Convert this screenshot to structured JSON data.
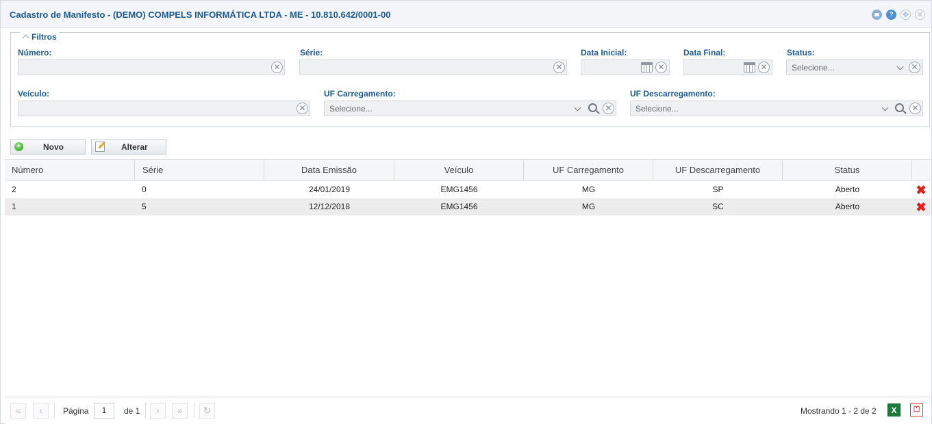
{
  "window": {
    "title": "Cadastro de Manifesto - (DEMO) COMPELS INFORMÁTICA LTDA - ME - 10.810.642/0001-00",
    "icons": [
      "minimize-icon",
      "help-icon",
      "move-icon",
      "close-icon"
    ]
  },
  "filters": {
    "legend": "Filtros",
    "numero": {
      "label": "Número:",
      "value": ""
    },
    "serie": {
      "label": "Série:",
      "value": ""
    },
    "data_inicial": {
      "label": "Data Inicial:",
      "value": ""
    },
    "data_final": {
      "label": "Data Final:",
      "value": ""
    },
    "status": {
      "label": "Status:",
      "placeholder": "Selecione..."
    },
    "veiculo": {
      "label": "Veículo:",
      "value": ""
    },
    "uf_carregamento": {
      "label": "UF Carregamento:",
      "placeholder": "Selecione..."
    },
    "uf_descarregamento": {
      "label": "UF Descarregamento:",
      "placeholder": "Selecione..."
    }
  },
  "toolbar": {
    "novo": "Novo",
    "alterar": "Alterar"
  },
  "table": {
    "headers": [
      "Número",
      "Série",
      "Data Emissão",
      "Veículo",
      "UF Carregamento",
      "UF Descarregamento",
      "Status"
    ],
    "rows": [
      {
        "numero": "2",
        "serie": "0",
        "data_emissao": "24/01/2019",
        "veiculo": "EMG1456",
        "uf_carregamento": "MG",
        "uf_descarregamento": "SP",
        "status": "Aberto"
      },
      {
        "numero": "1",
        "serie": "5",
        "data_emissao": "12/12/2018",
        "veiculo": "EMG1456",
        "uf_carregamento": "MG",
        "uf_descarregamento": "SC",
        "status": "Aberto"
      }
    ]
  },
  "pager": {
    "page_label": "Página",
    "page_value": "1",
    "of_label": "de 1",
    "showing": "Mostrando 1 - 2 de 2",
    "export_excel": "X",
    "export_pdf": "⏍"
  },
  "colors": {
    "title": "#1b5a92",
    "accent": "#4d8fcf",
    "delete": "#e02020",
    "excel": "#1e7b3c",
    "pdf": "#d9342b"
  }
}
